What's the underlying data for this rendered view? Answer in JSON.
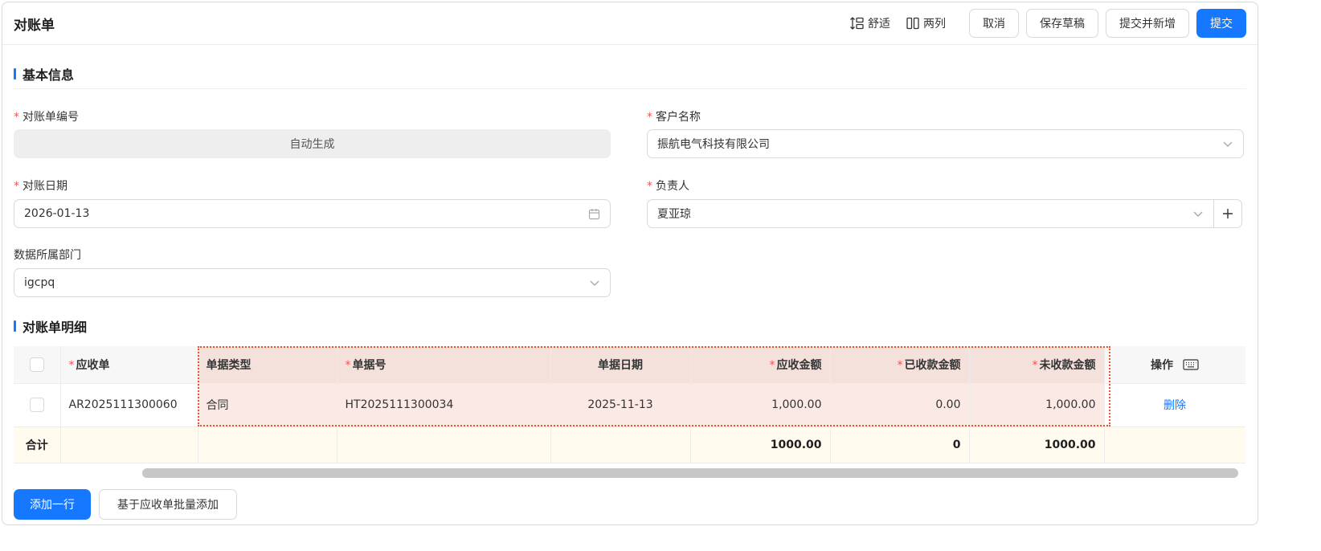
{
  "header": {
    "title": "对账单",
    "density_label": "舒适",
    "layout_label": "两列",
    "cancel_label": "取消",
    "save_draft_label": "保存草稿",
    "submit_and_new_label": "提交并新增",
    "submit_label": "提交"
  },
  "basic_section": {
    "title": "基本信息",
    "fields": {
      "statement_no": {
        "label": "对账单编号",
        "required": true,
        "value": "自动生成"
      },
      "customer_name": {
        "label": "客户名称",
        "required": true,
        "value": "振航电气科技有限公司"
      },
      "statement_date": {
        "label": "对账日期",
        "required": true,
        "value": "2026-01-13"
      },
      "owner": {
        "label": "负责人",
        "required": true,
        "value": "夏亚琼"
      },
      "department": {
        "label": "数据所属部门",
        "required": false,
        "value": "igcpq"
      }
    }
  },
  "detail_section": {
    "title": "对账单明细",
    "columns": {
      "receivable": "应收单",
      "doc_type": "单据类型",
      "doc_no": "单据号",
      "doc_date": "单据日期",
      "receivable_amount": "应收金额",
      "received_amount": "已收款金额",
      "unreceived_amount": "未收款金额",
      "action": "操作"
    },
    "rows": [
      {
        "receivable": "AR2025111300060",
        "doc_type": "合同",
        "doc_no": "HT2025111300034",
        "doc_date": "2025-11-13",
        "receivable_amount": "1,000.00",
        "received_amount": "0.00",
        "unreceived_amount": "1,000.00",
        "action": "删除"
      }
    ],
    "summary": {
      "label": "合计",
      "receivable_amount": "1000.00",
      "received_amount": "0",
      "unreceived_amount": "1000.00"
    }
  },
  "footer": {
    "add_row_label": "添加一行",
    "batch_add_label": "基于应收单批量添加"
  },
  "colors": {
    "primary": "#1677ff",
    "required": "#ff4d4f",
    "highlight_border": "#e8542c",
    "summary_bg": "#fffbee"
  }
}
